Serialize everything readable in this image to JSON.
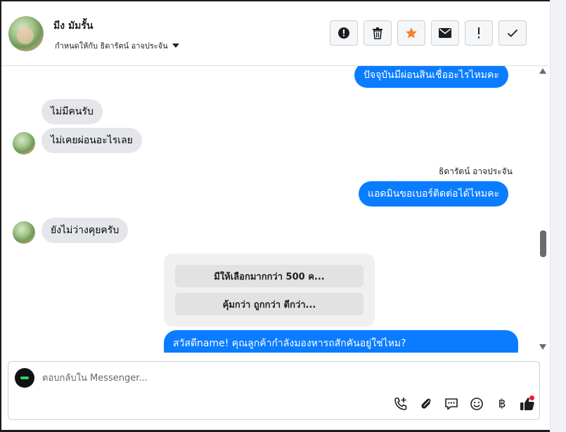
{
  "header": {
    "contact_name": "มีง มัมรั้น",
    "assign_label": "กำหนดให้กับ ธิดารัตน์ อาจประจัน",
    "actions": [
      "alert-circle-icon",
      "trash-icon",
      "star-icon",
      "mail-icon",
      "exclamation-icon",
      "check-icon"
    ],
    "star_color": "#f5832b"
  },
  "messages": [
    {
      "side": "out",
      "text": "ปัจจุบันมีผ่อนสินเชื่ออะไรไหมคะ"
    },
    {
      "side": "in",
      "text": "ไม่มีคนรับ"
    },
    {
      "side": "in",
      "text": "ไม่เคยผ่อนอะไรเลย"
    },
    {
      "side": "out",
      "sender": "ธิดารัตน์ อาจประจัน",
      "text": "แอดมินขอเบอร์ติดต่อได้ไหมคะ"
    },
    {
      "side": "in",
      "text": "ยังไม่ว่างคุยครับ"
    },
    {
      "side": "out",
      "text": "สวัสดีname! คุณลูกค้ากำลังมองหารถสักคันอยู่ใช่ไหม?"
    }
  ],
  "quick_replies": [
    "มีให้เลือกมากกว่า 500 ค...",
    "คุ้มกว่า ถูกกว่า ดีกว่า..."
  ],
  "composer": {
    "placeholder": "ตอบกลับใน Messenger...",
    "tools": [
      "phone-plus-icon",
      "paperclip-icon",
      "chat-bubble-icon",
      "emoji-icon",
      "baht-icon",
      "thumbs-up-icon"
    ],
    "baht_symbol": "฿"
  },
  "colors": {
    "outgoing_bubble": "#0a7cff",
    "incoming_bubble": "#e4e6eb"
  }
}
